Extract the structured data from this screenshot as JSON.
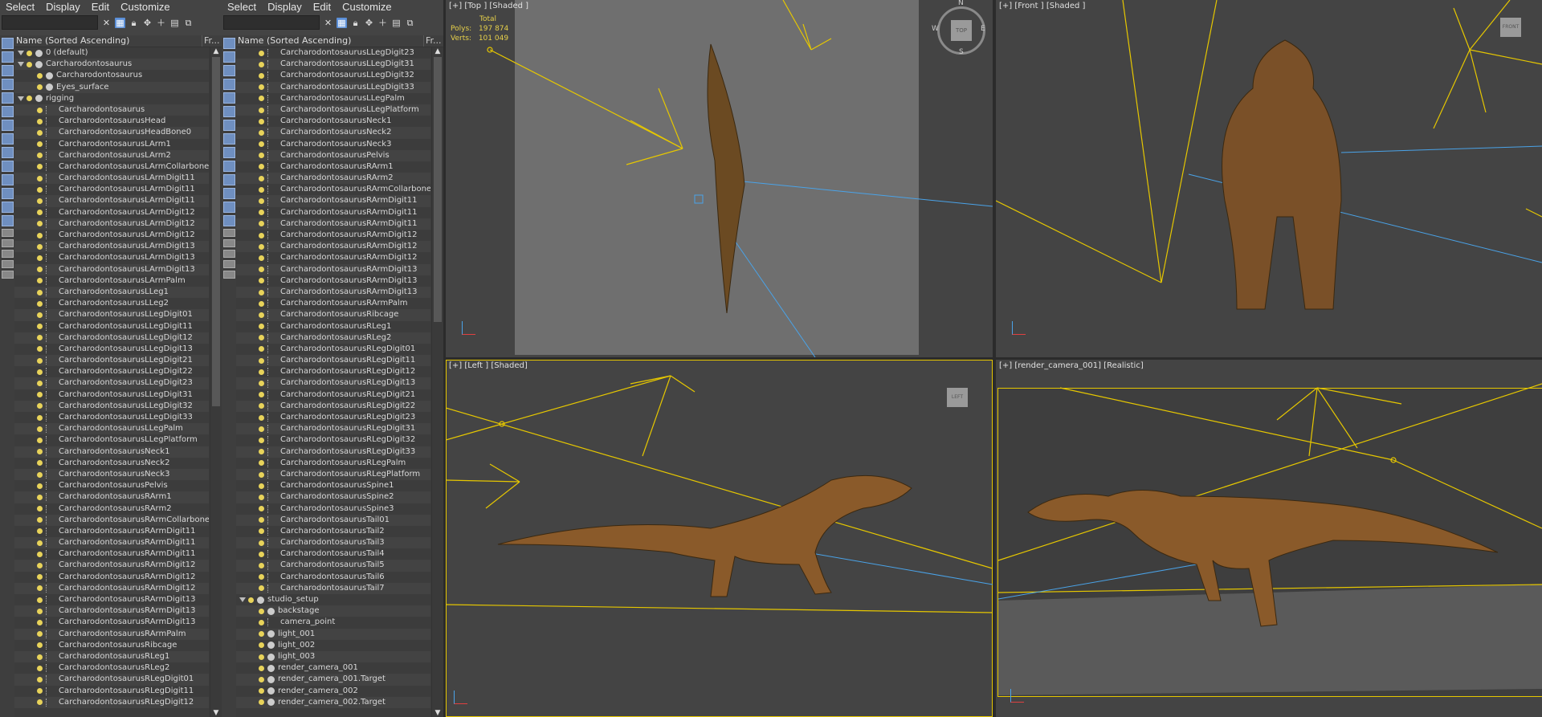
{
  "menu": [
    "Select",
    "Display",
    "Edit",
    "Customize"
  ],
  "explorer1": {
    "header": "Name (Sorted Ascending)",
    "header2": "Fr...",
    "rows": [
      {
        "t": "0 (default)",
        "lvl": 1,
        "k": "layer"
      },
      {
        "t": "Carcharodontosaurus",
        "lvl": 1,
        "k": "layer"
      },
      {
        "t": "Carcharodontosaurus",
        "lvl": 2,
        "k": "obj"
      },
      {
        "t": "Eyes_surface",
        "lvl": 2,
        "k": "obj"
      },
      {
        "t": "rigging",
        "lvl": 1,
        "k": "layer"
      },
      {
        "t": "Carcharodontosaurus",
        "lvl": 2,
        "k": "bone"
      },
      {
        "t": "CarcharodontosaurusHead",
        "lvl": 2,
        "k": "bone"
      },
      {
        "t": "CarcharodontosaurusHeadBone0",
        "lvl": 2,
        "k": "bone"
      },
      {
        "t": "CarcharodontosaurusLArm1",
        "lvl": 2,
        "k": "bone"
      },
      {
        "t": "CarcharodontosaurusLArm2",
        "lvl": 2,
        "k": "bone"
      },
      {
        "t": "CarcharodontosaurusLArmCollarbone",
        "lvl": 2,
        "k": "bone"
      },
      {
        "t": "CarcharodontosaurusLArmDigit11",
        "lvl": 2,
        "k": "bone"
      },
      {
        "t": "CarcharodontosaurusLArmDigit11",
        "lvl": 2,
        "k": "bone"
      },
      {
        "t": "CarcharodontosaurusLArmDigit11",
        "lvl": 2,
        "k": "bone"
      },
      {
        "t": "CarcharodontosaurusLArmDigit12",
        "lvl": 2,
        "k": "bone"
      },
      {
        "t": "CarcharodontosaurusLArmDigit12",
        "lvl": 2,
        "k": "bone"
      },
      {
        "t": "CarcharodontosaurusLArmDigit12",
        "lvl": 2,
        "k": "bone"
      },
      {
        "t": "CarcharodontosaurusLArmDigit13",
        "lvl": 2,
        "k": "bone"
      },
      {
        "t": "CarcharodontosaurusLArmDigit13",
        "lvl": 2,
        "k": "bone"
      },
      {
        "t": "CarcharodontosaurusLArmDigit13",
        "lvl": 2,
        "k": "bone"
      },
      {
        "t": "CarcharodontosaurusLArmPalm",
        "lvl": 2,
        "k": "bone"
      },
      {
        "t": "CarcharodontosaurusLLeg1",
        "lvl": 2,
        "k": "bone"
      },
      {
        "t": "CarcharodontosaurusLLeg2",
        "lvl": 2,
        "k": "bone"
      },
      {
        "t": "CarcharodontosaurusLLegDigit01",
        "lvl": 2,
        "k": "bone"
      },
      {
        "t": "CarcharodontosaurusLLegDigit11",
        "lvl": 2,
        "k": "bone"
      },
      {
        "t": "CarcharodontosaurusLLegDigit12",
        "lvl": 2,
        "k": "bone"
      },
      {
        "t": "CarcharodontosaurusLLegDigit13",
        "lvl": 2,
        "k": "bone"
      },
      {
        "t": "CarcharodontosaurusLLegDigit21",
        "lvl": 2,
        "k": "bone"
      },
      {
        "t": "CarcharodontosaurusLLegDigit22",
        "lvl": 2,
        "k": "bone"
      },
      {
        "t": "CarcharodontosaurusLLegDigit23",
        "lvl": 2,
        "k": "bone"
      },
      {
        "t": "CarcharodontosaurusLLegDigit31",
        "lvl": 2,
        "k": "bone"
      },
      {
        "t": "CarcharodontosaurusLLegDigit32",
        "lvl": 2,
        "k": "bone"
      },
      {
        "t": "CarcharodontosaurusLLegDigit33",
        "lvl": 2,
        "k": "bone"
      },
      {
        "t": "CarcharodontosaurusLLegPalm",
        "lvl": 2,
        "k": "bone"
      },
      {
        "t": "CarcharodontosaurusLLegPlatform",
        "lvl": 2,
        "k": "bone"
      },
      {
        "t": "CarcharodontosaurusNeck1",
        "lvl": 2,
        "k": "bone"
      },
      {
        "t": "CarcharodontosaurusNeck2",
        "lvl": 2,
        "k": "bone"
      },
      {
        "t": "CarcharodontosaurusNeck3",
        "lvl": 2,
        "k": "bone"
      },
      {
        "t": "CarcharodontosaurusPelvis",
        "lvl": 2,
        "k": "bone"
      },
      {
        "t": "CarcharodontosaurusRArm1",
        "lvl": 2,
        "k": "bone"
      },
      {
        "t": "CarcharodontosaurusRArm2",
        "lvl": 2,
        "k": "bone"
      },
      {
        "t": "CarcharodontosaurusRArmCollarbone",
        "lvl": 2,
        "k": "bone"
      },
      {
        "t": "CarcharodontosaurusRArmDigit11",
        "lvl": 2,
        "k": "bone"
      },
      {
        "t": "CarcharodontosaurusRArmDigit11",
        "lvl": 2,
        "k": "bone"
      },
      {
        "t": "CarcharodontosaurusRArmDigit11",
        "lvl": 2,
        "k": "bone"
      },
      {
        "t": "CarcharodontosaurusRArmDigit12",
        "lvl": 2,
        "k": "bone"
      },
      {
        "t": "CarcharodontosaurusRArmDigit12",
        "lvl": 2,
        "k": "bone"
      },
      {
        "t": "CarcharodontosaurusRArmDigit12",
        "lvl": 2,
        "k": "bone"
      },
      {
        "t": "CarcharodontosaurusRArmDigit13",
        "lvl": 2,
        "k": "bone"
      },
      {
        "t": "CarcharodontosaurusRArmDigit13",
        "lvl": 2,
        "k": "bone"
      },
      {
        "t": "CarcharodontosaurusRArmDigit13",
        "lvl": 2,
        "k": "bone"
      },
      {
        "t": "CarcharodontosaurusRArmPalm",
        "lvl": 2,
        "k": "bone"
      },
      {
        "t": "CarcharodontosaurusRibcage",
        "lvl": 2,
        "k": "bone"
      },
      {
        "t": "CarcharodontosaurusRLeg1",
        "lvl": 2,
        "k": "bone"
      },
      {
        "t": "CarcharodontosaurusRLeg2",
        "lvl": 2,
        "k": "bone"
      },
      {
        "t": "CarcharodontosaurusRLegDigit01",
        "lvl": 2,
        "k": "bone"
      },
      {
        "t": "CarcharodontosaurusRLegDigit11",
        "lvl": 2,
        "k": "bone"
      },
      {
        "t": "CarcharodontosaurusRLegDigit12",
        "lvl": 2,
        "k": "bone"
      }
    ]
  },
  "explorer2": {
    "header": "Name (Sorted Ascending)",
    "header2": "Fr...",
    "rows": [
      {
        "t": "CarcharodontosaurusLLegDigit23",
        "lvl": 2,
        "k": "bone"
      },
      {
        "t": "CarcharodontosaurusLLegDigit31",
        "lvl": 2,
        "k": "bone"
      },
      {
        "t": "CarcharodontosaurusLLegDigit32",
        "lvl": 2,
        "k": "bone"
      },
      {
        "t": "CarcharodontosaurusLLegDigit33",
        "lvl": 2,
        "k": "bone"
      },
      {
        "t": "CarcharodontosaurusLLegPalm",
        "lvl": 2,
        "k": "bone"
      },
      {
        "t": "CarcharodontosaurusLLegPlatform",
        "lvl": 2,
        "k": "bone"
      },
      {
        "t": "CarcharodontosaurusNeck1",
        "lvl": 2,
        "k": "bone"
      },
      {
        "t": "CarcharodontosaurusNeck2",
        "lvl": 2,
        "k": "bone"
      },
      {
        "t": "CarcharodontosaurusNeck3",
        "lvl": 2,
        "k": "bone"
      },
      {
        "t": "CarcharodontosaurusPelvis",
        "lvl": 2,
        "k": "bone"
      },
      {
        "t": "CarcharodontosaurusRArm1",
        "lvl": 2,
        "k": "bone"
      },
      {
        "t": "CarcharodontosaurusRArm2",
        "lvl": 2,
        "k": "bone"
      },
      {
        "t": "CarcharodontosaurusRArmCollarbone",
        "lvl": 2,
        "k": "bone"
      },
      {
        "t": "CarcharodontosaurusRArmDigit11",
        "lvl": 2,
        "k": "bone"
      },
      {
        "t": "CarcharodontosaurusRArmDigit11",
        "lvl": 2,
        "k": "bone"
      },
      {
        "t": "CarcharodontosaurusRArmDigit11",
        "lvl": 2,
        "k": "bone"
      },
      {
        "t": "CarcharodontosaurusRArmDigit12",
        "lvl": 2,
        "k": "bone"
      },
      {
        "t": "CarcharodontosaurusRArmDigit12",
        "lvl": 2,
        "k": "bone"
      },
      {
        "t": "CarcharodontosaurusRArmDigit12",
        "lvl": 2,
        "k": "bone"
      },
      {
        "t": "CarcharodontosaurusRArmDigit13",
        "lvl": 2,
        "k": "bone"
      },
      {
        "t": "CarcharodontosaurusRArmDigit13",
        "lvl": 2,
        "k": "bone"
      },
      {
        "t": "CarcharodontosaurusRArmDigit13",
        "lvl": 2,
        "k": "bone"
      },
      {
        "t": "CarcharodontosaurusRArmPalm",
        "lvl": 2,
        "k": "bone"
      },
      {
        "t": "CarcharodontosaurusRibcage",
        "lvl": 2,
        "k": "bone"
      },
      {
        "t": "CarcharodontosaurusRLeg1",
        "lvl": 2,
        "k": "bone"
      },
      {
        "t": "CarcharodontosaurusRLeg2",
        "lvl": 2,
        "k": "bone"
      },
      {
        "t": "CarcharodontosaurusRLegDigit01",
        "lvl": 2,
        "k": "bone"
      },
      {
        "t": "CarcharodontosaurusRLegDigit11",
        "lvl": 2,
        "k": "bone"
      },
      {
        "t": "CarcharodontosaurusRLegDigit12",
        "lvl": 2,
        "k": "bone"
      },
      {
        "t": "CarcharodontosaurusRLegDigit13",
        "lvl": 2,
        "k": "bone"
      },
      {
        "t": "CarcharodontosaurusRLegDigit21",
        "lvl": 2,
        "k": "bone"
      },
      {
        "t": "CarcharodontosaurusRLegDigit22",
        "lvl": 2,
        "k": "bone"
      },
      {
        "t": "CarcharodontosaurusRLegDigit23",
        "lvl": 2,
        "k": "bone"
      },
      {
        "t": "CarcharodontosaurusRLegDigit31",
        "lvl": 2,
        "k": "bone"
      },
      {
        "t": "CarcharodontosaurusRLegDigit32",
        "lvl": 2,
        "k": "bone"
      },
      {
        "t": "CarcharodontosaurusRLegDigit33",
        "lvl": 2,
        "k": "bone"
      },
      {
        "t": "CarcharodontosaurusRLegPalm",
        "lvl": 2,
        "k": "bone"
      },
      {
        "t": "CarcharodontosaurusRLegPlatform",
        "lvl": 2,
        "k": "bone"
      },
      {
        "t": "CarcharodontosaurusSpine1",
        "lvl": 2,
        "k": "bone"
      },
      {
        "t": "CarcharodontosaurusSpine2",
        "lvl": 2,
        "k": "bone"
      },
      {
        "t": "CarcharodontosaurusSpine3",
        "lvl": 2,
        "k": "bone"
      },
      {
        "t": "CarcharodontosaurusTail01",
        "lvl": 2,
        "k": "bone"
      },
      {
        "t": "CarcharodontosaurusTail2",
        "lvl": 2,
        "k": "bone"
      },
      {
        "t": "CarcharodontosaurusTail3",
        "lvl": 2,
        "k": "bone"
      },
      {
        "t": "CarcharodontosaurusTail4",
        "lvl": 2,
        "k": "bone"
      },
      {
        "t": "CarcharodontosaurusTail5",
        "lvl": 2,
        "k": "bone"
      },
      {
        "t": "CarcharodontosaurusTail6",
        "lvl": 2,
        "k": "bone"
      },
      {
        "t": "CarcharodontosaurusTail7",
        "lvl": 2,
        "k": "bone"
      },
      {
        "t": "studio_setup",
        "lvl": 1,
        "k": "layer"
      },
      {
        "t": "backstage",
        "lvl": 2,
        "k": "obj"
      },
      {
        "t": "camera_point",
        "lvl": 2,
        "k": "bone"
      },
      {
        "t": "light_001",
        "lvl": 2,
        "k": "light"
      },
      {
        "t": "light_002",
        "lvl": 2,
        "k": "light"
      },
      {
        "t": "light_003",
        "lvl": 2,
        "k": "light"
      },
      {
        "t": "render_camera_001",
        "lvl": 2,
        "k": "cam"
      },
      {
        "t": "render_camera_001.Target",
        "lvl": 2,
        "k": "cam"
      },
      {
        "t": "render_camera_002",
        "lvl": 2,
        "k": "cam"
      },
      {
        "t": "render_camera_002.Target",
        "lvl": 2,
        "k": "cam"
      }
    ]
  },
  "viewports": {
    "top": {
      "label": "[+] [Top ] [Shaded ]",
      "stats_total": "Total",
      "polys_label": "Polys:",
      "polys": "197 874",
      "verts_label": "Verts:",
      "verts": "101 049"
    },
    "front": {
      "label": "[+] [Front ] [Shaded ]"
    },
    "left": {
      "label": "[+] [Left ] [Shaded]"
    },
    "camera": {
      "label": "[+] [render_camera_001] [Realistic]"
    }
  },
  "viewcube": {
    "top": "TOP",
    "front": "FRONT",
    "left": "LEFT",
    "n": "N",
    "s": "S",
    "e": "E",
    "w": "W"
  },
  "colors": {
    "helper": "#e6c700",
    "link": "#4aa3e8",
    "dino": "#8a5a2a",
    "panel": "#444444"
  }
}
